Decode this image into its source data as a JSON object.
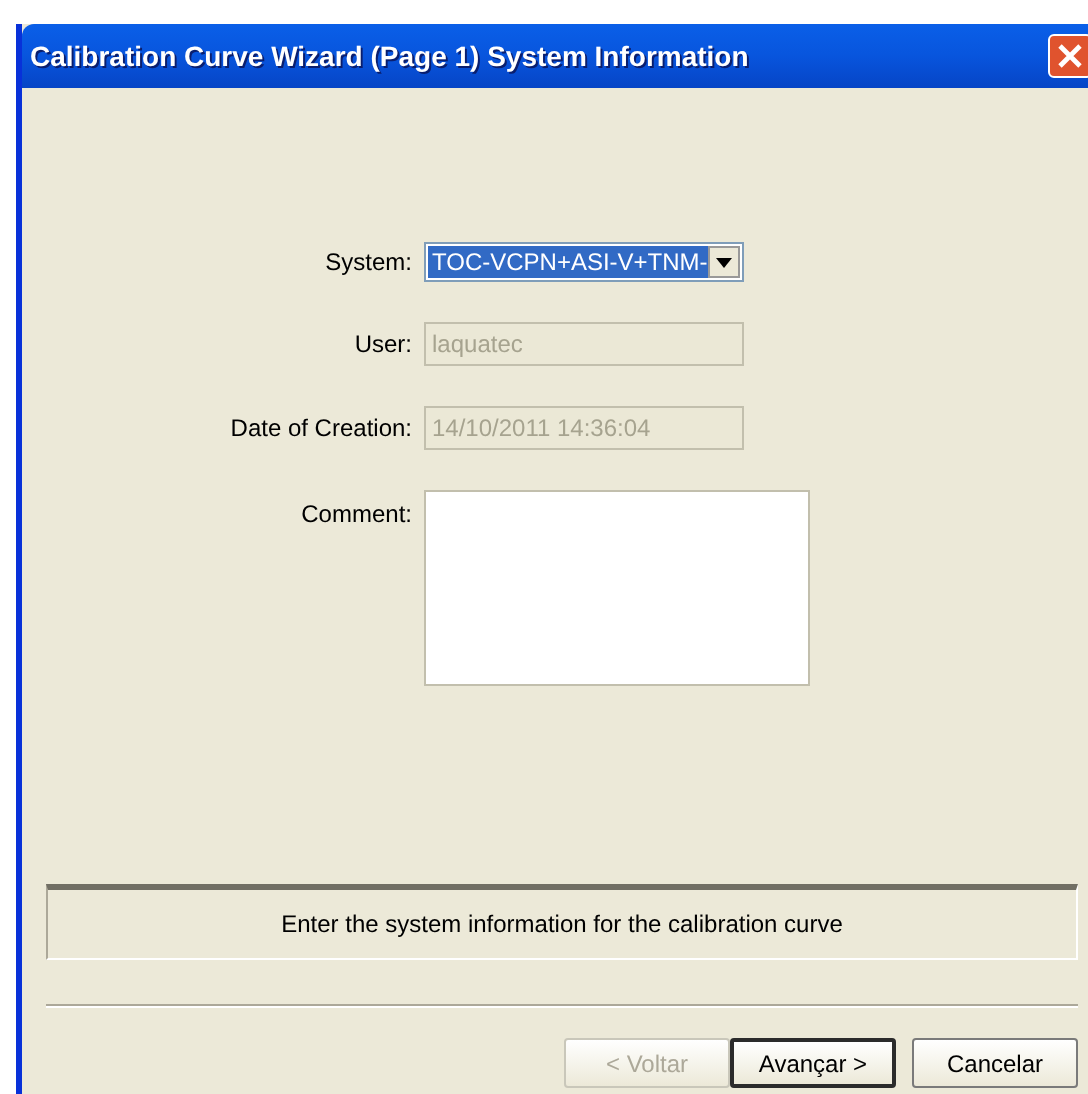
{
  "window": {
    "title": "Calibration Curve Wizard (Page 1) System Information"
  },
  "fields": [
    {
      "kind": "dropdown",
      "label": "System:",
      "value": "TOC-VCPN+ASI-V+TNM-",
      "disabled": false,
      "selected": true
    },
    {
      "kind": "text",
      "label": "User:",
      "value": "laquatec",
      "disabled": true,
      "selected": false
    },
    {
      "kind": "text",
      "label": "Date of Creation:",
      "value": "14/10/2011 14:36:04",
      "disabled": true,
      "selected": false
    },
    {
      "kind": "multiline",
      "label": "Comment:",
      "disabled": false,
      "selected": false
    }
  ],
  "hint": "Enter the system information for the calibration curve",
  "buttons": [
    {
      "label": "< Voltar",
      "disabled": true,
      "default": false
    },
    {
      "label": "Avançar >",
      "disabled": false,
      "default": true
    },
    {
      "label": "Cancelar",
      "disabled": false,
      "default": false
    }
  ]
}
